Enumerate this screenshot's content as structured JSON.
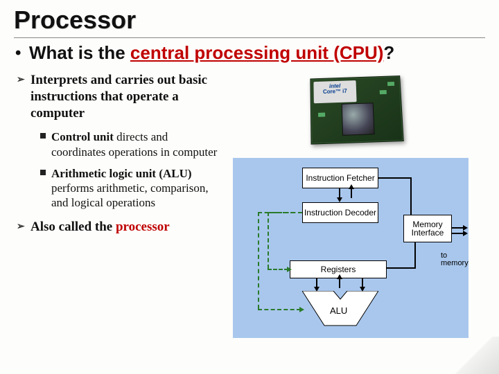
{
  "title": "Processor",
  "question": {
    "prefix": "What is the ",
    "hl": "central processing unit (CPU)",
    "suffix": "?"
  },
  "points": {
    "interprets": "Interprets and carries out basic instructions that operate a computer",
    "control_unit_b": "Control unit",
    "control_unit_rest": " directs and coordinates operations in computer",
    "alu_b": "Arithmetic logic unit (ALU)",
    "alu_rest": " performs arithmetic, comparison, and logical operations",
    "also_prefix": "Also called the ",
    "also_hl": "processor"
  },
  "chip": {
    "brand": "intel",
    "model": "Core™ i7"
  },
  "diagram": {
    "fetcher": "Instruction Fetcher",
    "decoder": "Instruction Decoder",
    "mem_if": "Memory Interface",
    "registers": "Registers",
    "alu": "ALU",
    "ext": "to memory"
  }
}
